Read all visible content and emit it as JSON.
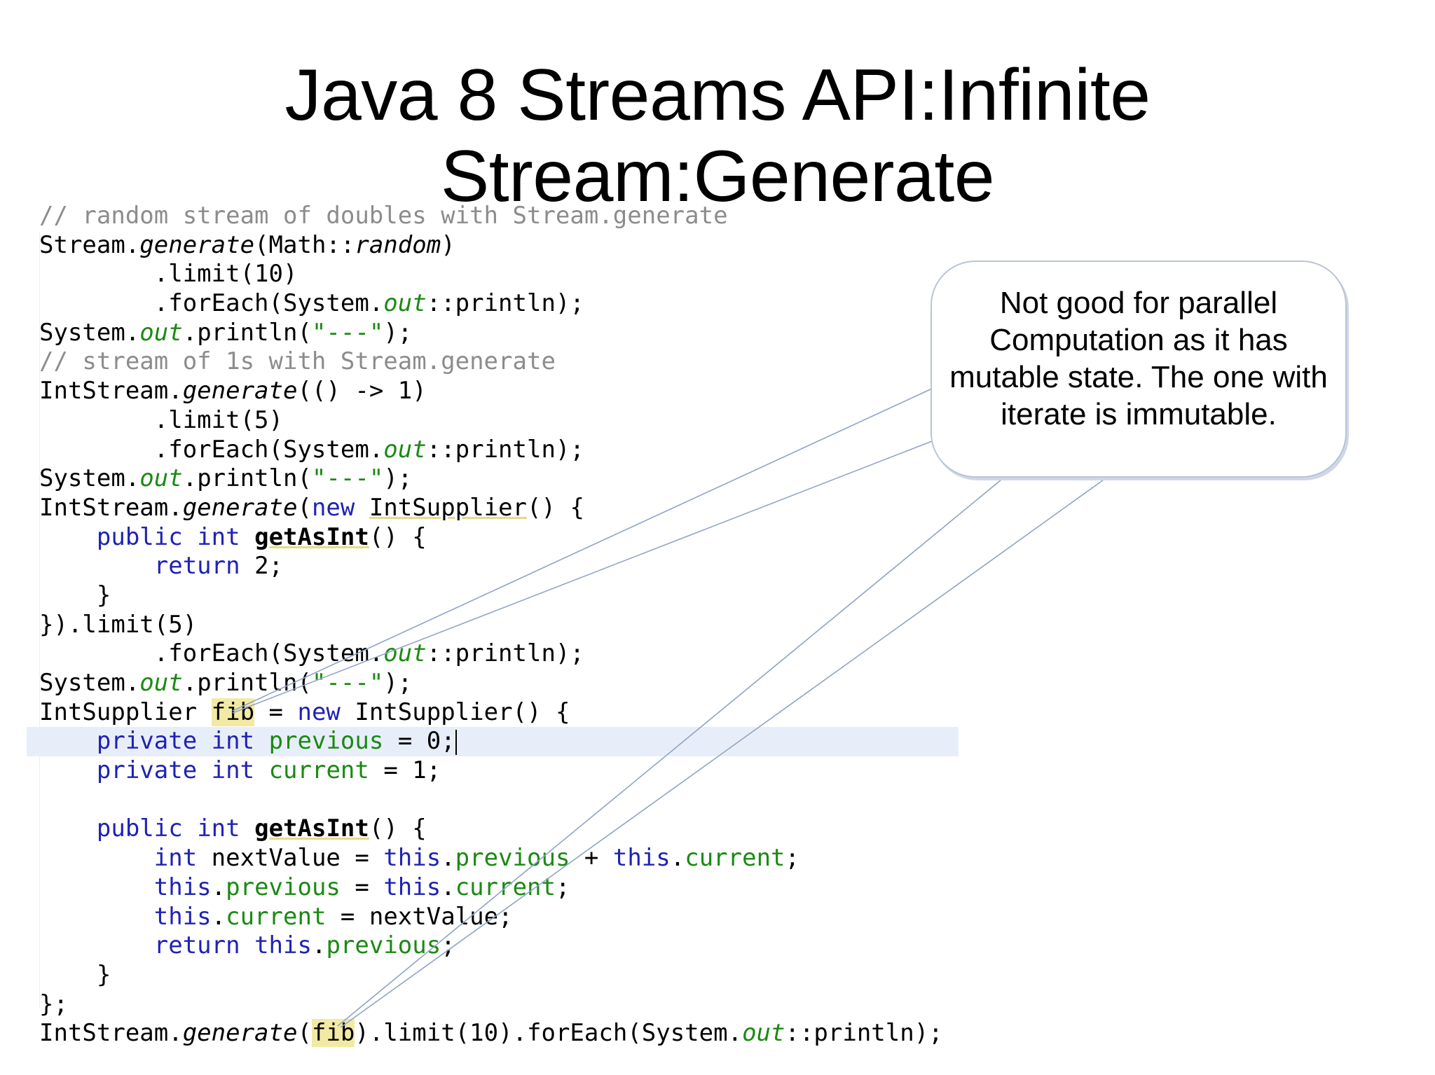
{
  "slide": {
    "title_line1": "Java 8 Streams API:Infinite",
    "title_line2": "Stream:Generate"
  },
  "code": {
    "l1_comment": "// random stream of doubles with Stream.generate",
    "l2_a": "Stream.",
    "l2_b": "generate",
    "l2_c": "(Math::",
    "l2_d": "random",
    "l2_e": ")",
    "l3": "        .limit(10)",
    "l4_a": "        .forEach(System.",
    "l4_b": "out",
    "l4_c": "::println);",
    "l5_a": "System.",
    "l5_b": "out",
    "l5_c": ".println(",
    "l5_d": "\"---\"",
    "l5_e": ");",
    "l6_comment": "// stream of 1s with Stream.generate",
    "l7_a": "IntStream.",
    "l7_b": "generate",
    "l7_c": "(() -> 1)",
    "l8": "        .limit(5)",
    "l9_a": "        .forEach(System.",
    "l9_b": "out",
    "l9_c": "::println);",
    "l10_a": "System.",
    "l10_b": "out",
    "l10_c": ".println(",
    "l10_d": "\"---\"",
    "l10_e": ");",
    "l11_a": "IntStream.",
    "l11_b": "generate",
    "l11_c": "(",
    "l11_d": "new",
    "l11_e": " ",
    "l11_f": "IntSupplier",
    "l11_g": "() {",
    "l12_a": "    ",
    "l12_b": "public",
    "l12_c": " ",
    "l12_d": "int",
    "l12_e": " ",
    "l12_f": "getAsInt",
    "l12_g": "() {",
    "l13_a": "        ",
    "l13_b": "return",
    "l13_c": " 2;",
    "l14": "    }",
    "l15": "}).limit(5)",
    "l16_a": "        .forEach(System.",
    "l16_b": "out",
    "l16_c": "::println);",
    "l17_a": "System.",
    "l17_b": "out",
    "l17_c": ".println(",
    "l17_d": "\"---\"",
    "l17_e": ");",
    "l18_a": "IntSupplier ",
    "l18_b": "fib",
    "l18_c": " = ",
    "l18_d": "new",
    "l18_e": " IntSupplier() {",
    "l19_a": "    ",
    "l19_b": "private",
    "l19_c": " ",
    "l19_d": "int",
    "l19_e": " ",
    "l19_f": "previous",
    "l19_g": " = 0;",
    "l20_a": "    ",
    "l20_b": "private",
    "l20_c": " ",
    "l20_d": "int",
    "l20_e": " ",
    "l20_f": "current",
    "l20_g": " = 1;",
    "l21": " ",
    "l22_a": "    ",
    "l22_b": "public",
    "l22_c": " ",
    "l22_d": "int",
    "l22_e": " ",
    "l22_f": "getAsInt",
    "l22_g": "() {",
    "l23_a": "        ",
    "l23_b": "int",
    "l23_c": " nextValue = ",
    "l23_d": "this",
    "l23_e": ".",
    "l23_f": "previous",
    "l23_g": " + ",
    "l23_h": "this",
    "l23_i": ".",
    "l23_j": "current",
    "l23_k": ";",
    "l24_a": "        ",
    "l24_b": "this",
    "l24_c": ".",
    "l24_d": "previous",
    "l24_e": " = ",
    "l24_f": "this",
    "l24_g": ".",
    "l24_h": "current",
    "l24_i": ";",
    "l25_a": "        ",
    "l25_b": "this",
    "l25_c": ".",
    "l25_d": "current",
    "l25_e": " = nextValue;",
    "l26_a": "        ",
    "l26_b": "return",
    "l26_c": " ",
    "l26_d": "this",
    "l26_e": ".",
    "l26_f": "previous",
    "l26_g": ";",
    "l27": "    }",
    "l28": "};",
    "l29_a": "IntStream.",
    "l29_b": "generate",
    "l29_c": "(",
    "l29_d": "fib",
    "l29_e": ").limit(10).forEach(System.",
    "l29_f": "out",
    "l29_g": "::println);"
  },
  "callout": {
    "line1": "Not good for parallel",
    "line2": "Computation as it has",
    "line3": "mutable state. The one with",
    "line4": "iterate is immutable."
  },
  "colors": {
    "keyword": "#1f22b5",
    "field": "#1a8a12",
    "comment": "#8c8c8c",
    "highlight": "#f2eaa4",
    "current_line": "#e8eef9"
  }
}
